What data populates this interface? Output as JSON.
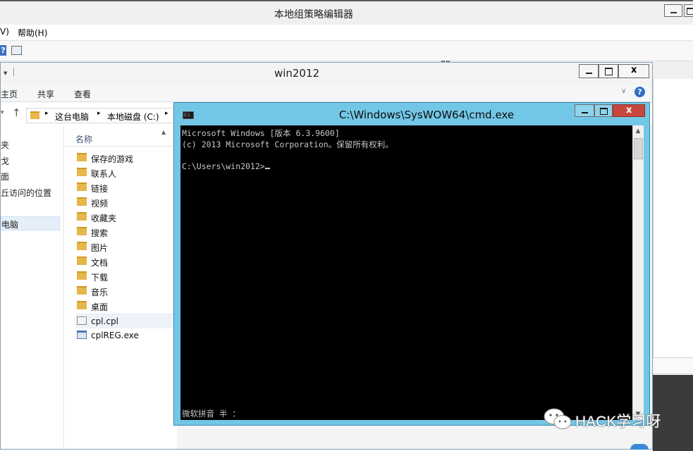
{
  "gpe": {
    "title": "本地组策略编辑器",
    "menu": [
      "V)",
      "帮助(H)"
    ]
  },
  "explorer": {
    "title": "win2012",
    "ribbon": [
      "主页",
      "共享",
      "查看"
    ],
    "breadcrumb": [
      "这台电脑",
      "本地磁盘 (C:)"
    ],
    "leftnav": [
      "夹",
      "戈",
      "面",
      "丘访问的位置",
      "电脑"
    ],
    "column_name": "名称",
    "files": [
      {
        "name": "保存的游戏",
        "icon": "folder-icon"
      },
      {
        "name": "联系人",
        "icon": "folder-icon"
      },
      {
        "name": "链接",
        "icon": "folder-icon"
      },
      {
        "name": "视频",
        "icon": "folder-icon"
      },
      {
        "name": "收藏夹",
        "icon": "folder-icon"
      },
      {
        "name": "搜索",
        "icon": "folder-icon"
      },
      {
        "name": "图片",
        "icon": "folder-icon"
      },
      {
        "name": "文档",
        "icon": "folder-icon"
      },
      {
        "name": "下载",
        "icon": "folder-icon"
      },
      {
        "name": "音乐",
        "icon": "folder-icon"
      },
      {
        "name": "桌面",
        "icon": "folder-icon"
      },
      {
        "name": "cpl.cpl",
        "icon": "cpl-file-icon"
      },
      {
        "name": "cplREG.exe",
        "icon": "exe-file-icon"
      }
    ]
  },
  "cmd": {
    "title": "C:\\Windows\\SysWOW64\\cmd.exe",
    "lines": [
      "Microsoft Windows [版本 6.3.9600]",
      "(c) 2013 Microsoft Corporation。保留所有权利。",
      "",
      "C:\\Users\\win2012>"
    ],
    "ime_status": "微软拼音 半 ："
  },
  "watermark": "HACK学习呀",
  "colors": {
    "cmd_frame": "#73c7e6",
    "console_bg": "#000000",
    "console_fg": "#c7c7c7",
    "close_red": "#c7473d"
  }
}
